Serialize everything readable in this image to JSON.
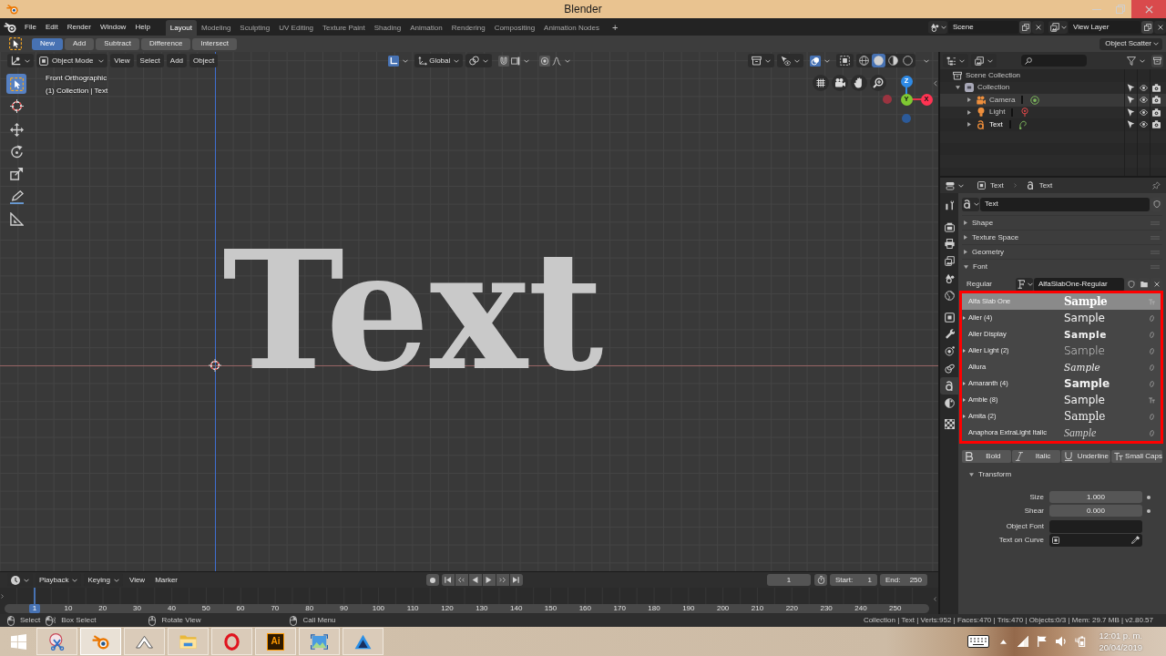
{
  "window": {
    "title": "Blender"
  },
  "topbar": {
    "menus": [
      "File",
      "Edit",
      "Render",
      "Window",
      "Help"
    ],
    "workspaces": [
      {
        "label": "Layout",
        "selected": true
      },
      {
        "label": "Modeling",
        "selected": false
      },
      {
        "label": "Sculpting",
        "selected": false
      },
      {
        "label": "UV Editing",
        "selected": false
      },
      {
        "label": "Texture Paint",
        "selected": false
      },
      {
        "label": "Shading",
        "selected": false
      },
      {
        "label": "Animation",
        "selected": false
      },
      {
        "label": "Rendering",
        "selected": false
      },
      {
        "label": "Compositing",
        "selected": false
      },
      {
        "label": "Animation Nodes",
        "selected": false
      }
    ],
    "add_workspace": "+",
    "scene": "Scene",
    "view_layer": "View Layer"
  },
  "tool_header": {
    "operations": [
      {
        "label": "New",
        "selected": true
      },
      {
        "label": "Add",
        "selected": false
      },
      {
        "label": "Subtract",
        "selected": false
      },
      {
        "label": "Difference",
        "selected": false
      },
      {
        "label": "Intersect",
        "selected": false
      }
    ],
    "preset": "Object Scatter"
  },
  "viewport": {
    "mode": "Object Mode",
    "menus": [
      "View",
      "Select",
      "Add",
      "Object"
    ],
    "orientation": "Global",
    "shading": [
      {
        "kind": "wireframe",
        "selected": false
      },
      {
        "kind": "solid",
        "selected": true
      },
      {
        "kind": "material",
        "selected": false
      },
      {
        "kind": "rendered",
        "selected": false
      }
    ],
    "tools": [
      {
        "kind": "select",
        "selected": true
      },
      {
        "kind": "cursor",
        "selected": false
      },
      {
        "kind": "move",
        "selected": false
      },
      {
        "kind": "rotate",
        "selected": false
      },
      {
        "kind": "scale",
        "selected": false
      },
      {
        "kind": "annotate",
        "selected": false
      },
      {
        "kind": "measure",
        "selected": false
      }
    ],
    "info": [
      "Front Orthographic",
      "(1) Collection | Text"
    ],
    "gizmo_axes": [
      "Z",
      "Y",
      "X"
    ],
    "object_text": "Text"
  },
  "outliner": {
    "tree": [
      {
        "label": "Scene Collection",
        "kind": "scene_collection",
        "selected": false,
        "active": false,
        "children": [
          {
            "label": "Collection",
            "kind": "collection",
            "expanded": true,
            "selected": false,
            "active": false,
            "children": [
              {
                "label": "Camera",
                "kind": "camera",
                "expanded": false,
                "selected": true,
                "active": false
              },
              {
                "label": "Light",
                "kind": "light",
                "expanded": false,
                "selected": false,
                "active": false
              },
              {
                "label": "Text",
                "kind": "text",
                "expanded": false,
                "selected": false,
                "active": true
              }
            ]
          }
        ]
      }
    ]
  },
  "properties": {
    "object": "Text",
    "data": "Text",
    "tabs": [
      {
        "kind": "tool",
        "selected": false
      },
      {
        "kind": "render",
        "selected": false
      },
      {
        "kind": "output",
        "selected": false
      },
      {
        "kind": "view_layer",
        "selected": false
      },
      {
        "kind": "scene",
        "selected": false
      },
      {
        "kind": "world",
        "selected": false
      },
      {
        "kind": "object",
        "selected": false
      },
      {
        "kind": "modifiers",
        "selected": false
      },
      {
        "kind": "particles",
        "selected": false
      },
      {
        "kind": "physics",
        "selected": false
      },
      {
        "kind": "data",
        "selected": true
      },
      {
        "kind": "material",
        "selected": false
      },
      {
        "kind": "texture",
        "selected": false
      }
    ],
    "datablock": "Text",
    "panels": [
      {
        "label": "Shape",
        "expanded": false
      },
      {
        "label": "Texture Space",
        "expanded": false
      },
      {
        "label": "Geometry",
        "expanded": false
      },
      {
        "label": "Font",
        "expanded": true,
        "font_slot": {
          "label": "Regular",
          "value": "AlfaSlabOne-Regular"
        },
        "font_list": [
          {
            "name": "Alfa Slab One",
            "sample": "Sample",
            "kind": "heavy",
            "truetype": true,
            "expandable": false,
            "selected": true
          },
          {
            "name": "Aller (4)",
            "sample": "Sample",
            "kind": "sans",
            "truetype": false,
            "expandable": true,
            "selected": false
          },
          {
            "name": "Aller Display",
            "sample": "Sample",
            "kind": "smallcaps",
            "truetype": false,
            "expandable": false,
            "selected": false
          },
          {
            "name": "Aller Light (2)",
            "sample": "Sample",
            "kind": "light",
            "truetype": false,
            "expandable": true,
            "selected": false
          },
          {
            "name": "Allura",
            "sample": "Sample",
            "kind": "script",
            "truetype": false,
            "expandable": false,
            "selected": false
          },
          {
            "name": "Amaranth (4)",
            "sample": "Sample",
            "kind": "bold",
            "truetype": false,
            "expandable": true,
            "selected": false
          },
          {
            "name": "Amble (8)",
            "sample": "Sample",
            "kind": "sans",
            "truetype": true,
            "expandable": true,
            "selected": false
          },
          {
            "name": "Amita (2)",
            "sample": "Sample",
            "kind": "serif",
            "truetype": false,
            "expandable": true,
            "selected": false
          },
          {
            "name": "Anaphora ExtraLight Italic",
            "sample": "Sample",
            "kind": "lightitalic",
            "truetype": false,
            "expandable": false,
            "selected": false
          }
        ],
        "style_toggles": [
          {
            "kind": "bold",
            "label": "Bold"
          },
          {
            "kind": "italic",
            "label": "Italic"
          },
          {
            "kind": "underline",
            "label": "Underline"
          },
          {
            "kind": "small_caps",
            "label": "Small Caps"
          }
        ],
        "transform": {
          "label": "Transform",
          "expanded": true,
          "fields": [
            {
              "label": "Size",
              "kind": "number",
              "value": "1.000"
            },
            {
              "label": "Shear",
              "kind": "number",
              "value": "0.000"
            },
            {
              "label": "Object Font",
              "kind": "object"
            },
            {
              "label": "Text on Curve",
              "kind": "object_picker"
            }
          ]
        }
      }
    ]
  },
  "timeline": {
    "menus": [
      {
        "label": "Playback",
        "dropdown": true
      },
      {
        "label": "Keying",
        "dropdown": true
      },
      {
        "label": "View",
        "dropdown": false
      },
      {
        "label": "Marker",
        "dropdown": false
      }
    ],
    "current_frame": "1",
    "start": {
      "label": "Start:",
      "value": "1"
    },
    "end": {
      "label": "End:",
      "value": "250"
    },
    "playhead": "1",
    "ruler": [
      "10",
      "20",
      "30",
      "40",
      "50",
      "60",
      "70",
      "80",
      "90",
      "100",
      "110",
      "120",
      "130",
      "140",
      "150",
      "160",
      "170",
      "180",
      "190",
      "200",
      "210",
      "220",
      "230",
      "240",
      "250"
    ]
  },
  "status_bar": {
    "hints": [
      {
        "kind": "left",
        "label": "Select"
      },
      {
        "kind": "drag",
        "label": "Box Select"
      },
      {
        "kind": "middle",
        "label": "Rotate View"
      },
      {
        "kind": "right",
        "label": "Call Menu"
      }
    ],
    "stats": "Collection | Text | Verts:952 | Faces:470 | Tris:470 | Objects:0/3 | Mem: 29.7 MB | v2.80.57"
  },
  "taskbar": {
    "apps": [
      {
        "kind": "snipping",
        "active": false
      },
      {
        "kind": "blender",
        "active": true
      },
      {
        "kind": "cloud",
        "active": false
      },
      {
        "kind": "explorer",
        "active": false
      },
      {
        "kind": "opera",
        "active": false
      },
      {
        "kind": "illustrator",
        "label": "Ai",
        "active": false
      },
      {
        "kind": "photos",
        "active": false
      },
      {
        "kind": "affinity",
        "active": false
      }
    ],
    "time": "12:01 p. m.",
    "date": "20/04/2019"
  }
}
